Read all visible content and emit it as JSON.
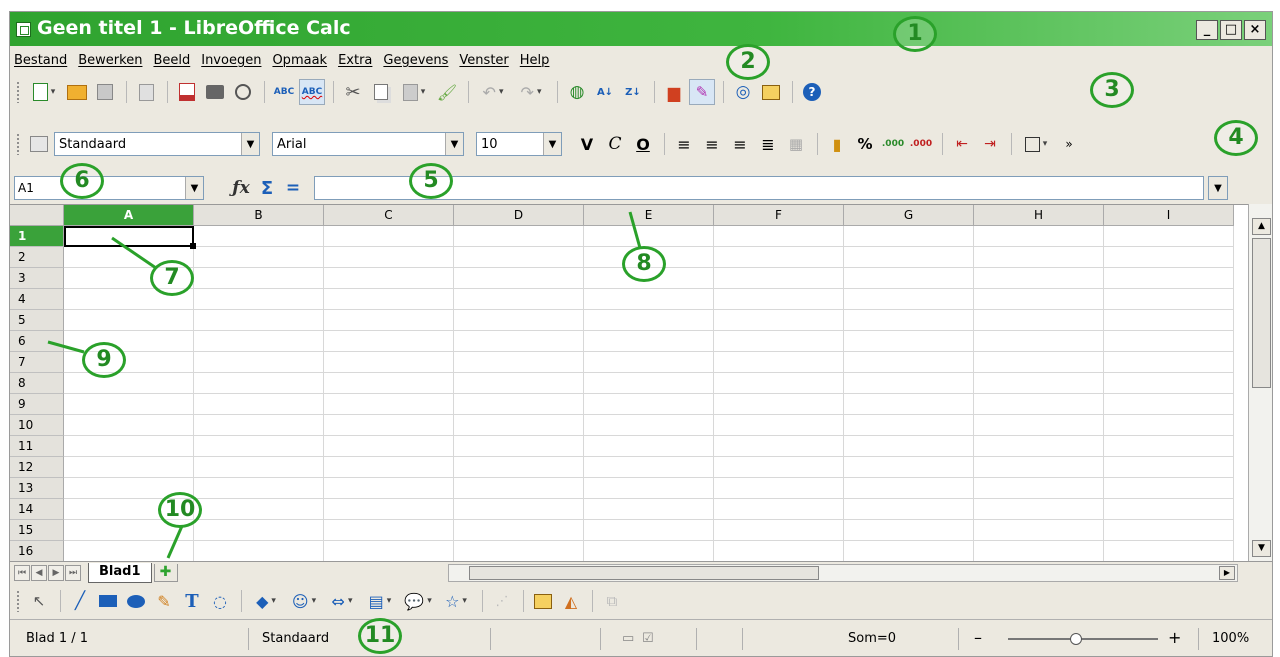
{
  "window": {
    "title": "Geen titel 1 - LibreOffice Calc",
    "min_label": "_",
    "max_label": "□",
    "close_label": "×"
  },
  "menu": [
    "Bestand",
    "Bewerken",
    "Beeld",
    "Invoegen",
    "Opmaak",
    "Extra",
    "Gegevens",
    "Venster",
    "Help"
  ],
  "formatting": {
    "style": "Standaard",
    "font": "Arial",
    "size": "10",
    "bold": "V",
    "italic": "C",
    "underline": "O",
    "percent": "%"
  },
  "formula_bar": {
    "cell_ref": "A1",
    "fx": "ƒx",
    "sum": "Σ",
    "equals": "=",
    "content": ""
  },
  "columns": [
    "A",
    "B",
    "C",
    "D",
    "E",
    "F",
    "G",
    "H",
    "I"
  ],
  "rows": [
    "1",
    "2",
    "3",
    "4",
    "5",
    "6",
    "7",
    "8",
    "9",
    "10",
    "11",
    "12",
    "13",
    "14",
    "15",
    "16"
  ],
  "selected_cell": "A1",
  "sheets": {
    "active": "Blad1"
  },
  "status": {
    "sheet": "Blad 1 / 1",
    "page_style": "Standaard",
    "sum": "Som=0",
    "zoom": "100%",
    "zoom_minus": "–",
    "zoom_plus": "+"
  },
  "callouts": [
    "1",
    "2",
    "3",
    "4",
    "5",
    "6",
    "7",
    "8",
    "9",
    "10",
    "11"
  ],
  "colors": {
    "title_green": "#2fa32f",
    "callout_green": "#2aa12a",
    "selection_green": "#3aa23a"
  }
}
